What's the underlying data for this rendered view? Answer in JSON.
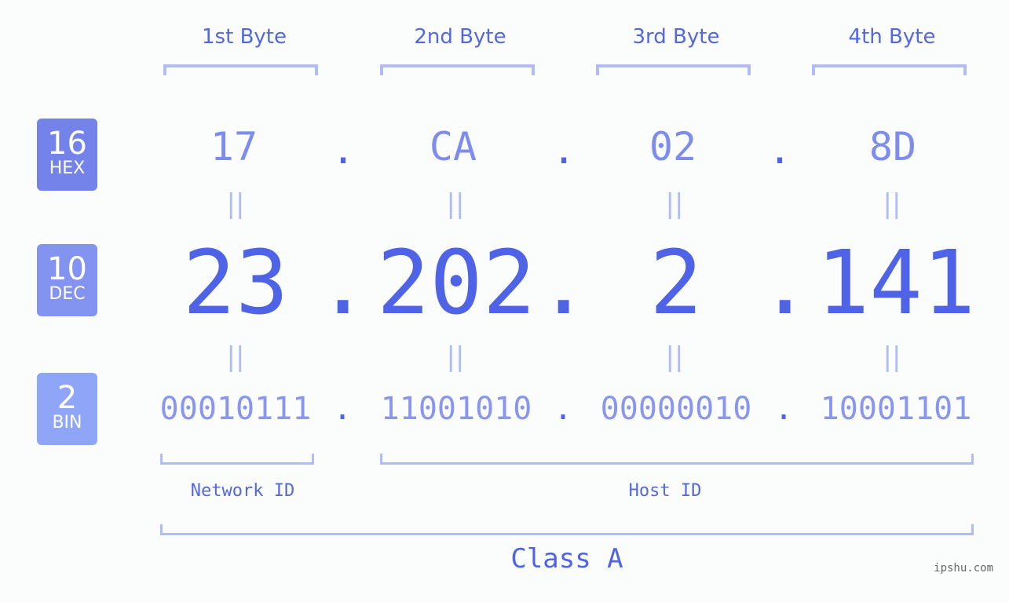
{
  "bytes": [
    {
      "label": "1st Byte",
      "hex": "17",
      "dec": "23",
      "bin": "00010111"
    },
    {
      "label": "2nd Byte",
      "hex": "CA",
      "dec": "202",
      "bin": "11001010"
    },
    {
      "label": "3rd Byte",
      "hex": "02",
      "dec": "2",
      "bin": "00000010"
    },
    {
      "label": "4th Byte",
      "hex": "8D",
      "dec": "141",
      "bin": "10001101"
    }
  ],
  "badges": {
    "hex": {
      "num": "16",
      "label": "HEX",
      "color": "#7383ea"
    },
    "dec": {
      "num": "10",
      "label": "DEC",
      "color": "#8393f0"
    },
    "bin": {
      "num": "2",
      "label": "BIN",
      "color": "#8fa6f8"
    }
  },
  "separator": ".",
  "equals": "||",
  "network_id": "Network ID",
  "host_id": "Host ID",
  "ip_class": "Class A",
  "watermark": "ipshu.com"
}
